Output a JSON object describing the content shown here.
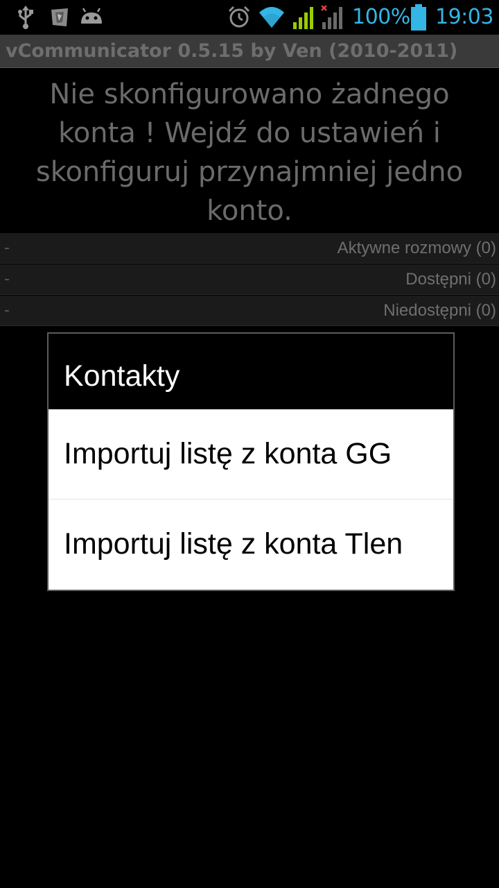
{
  "status_bar": {
    "battery_percent": "100%",
    "time": "19:03",
    "accent_color": "#33b5e5",
    "signal_color": "#99cc00",
    "icons": [
      "usb-icon",
      "notification-icon",
      "android-icon",
      "alarm-icon",
      "wifi-icon",
      "signal-icon",
      "no-signal-icon",
      "battery-icon"
    ]
  },
  "app": {
    "title": "vCommunicator 0.5.15 by Ven (2010-2011)"
  },
  "message": "Nie skonfigurowano żadnego konta ! Wejdź do ustawień i skonfiguruj przynajmniej jedno konto.",
  "groups": [
    {
      "dash": "-",
      "label": "Aktywne rozmowy (0)"
    },
    {
      "dash": "-",
      "label": "Dostępni (0)"
    },
    {
      "dash": "-",
      "label": "Niedostępni (0)"
    }
  ],
  "dialog": {
    "title": "Kontakty",
    "items": [
      {
        "label": "Importuj listę z konta GG"
      },
      {
        "label": "Importuj listę z konta Tlen"
      }
    ]
  }
}
